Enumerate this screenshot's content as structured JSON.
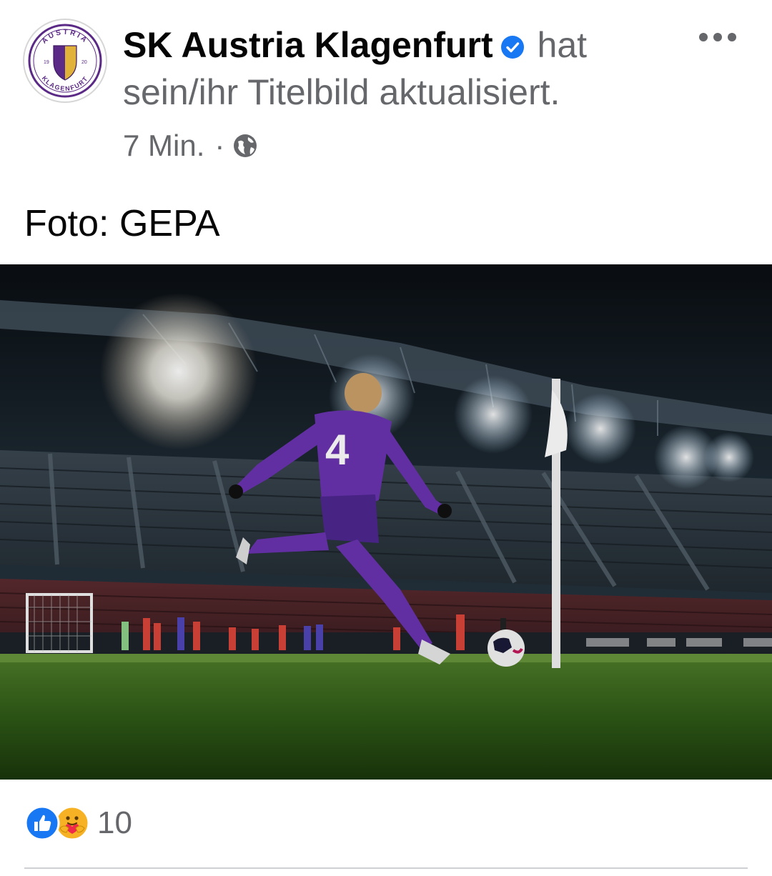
{
  "post": {
    "author": "SK Austria Klagenfurt",
    "action_text": " hat sein/ihr Titelbild aktualisiert.",
    "timestamp": "7 Min.",
    "separator": "·",
    "audience_icon": "globe-icon",
    "verified_icon": "verified-badge-icon",
    "more_icon": "more-options-icon",
    "caption": "Foto: GEPA",
    "photo_description_icon": "cover-photo"
  },
  "logo": {
    "text_top": "AUSTRIA",
    "text_bottom": "KLAGENFURT",
    "year_left": "19",
    "year_right": "20"
  },
  "reactions": {
    "icons": [
      "like-icon",
      "care-icon"
    ],
    "count": "10"
  },
  "colors": {
    "primary_text": "#050505",
    "secondary_text": "#65676b",
    "facebook_blue": "#1877f2",
    "club_purple": "#5b2a86",
    "club_gold": "#e0b23a",
    "divider": "#ced0d4"
  }
}
